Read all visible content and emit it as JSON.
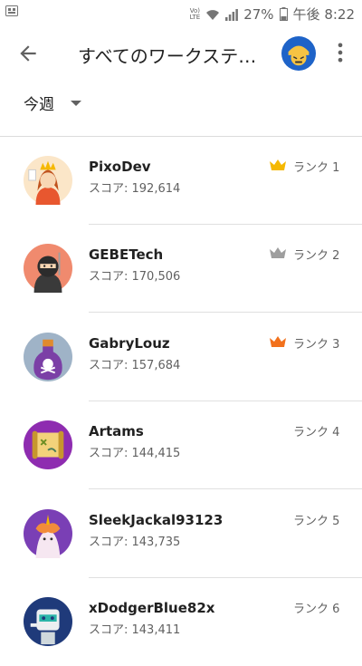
{
  "status_bar": {
    "battery": "27%",
    "time": "午後 8:22"
  },
  "app_bar": {
    "title": "すべてのワークステーション"
  },
  "filter": {
    "period": "今週"
  },
  "leaderboard": {
    "score_prefix": "スコア: ",
    "rows": [
      {
        "name": "PixoDev",
        "score": "192,614",
        "rank": "ランク 1",
        "crown": "gold",
        "avatar": "queen"
      },
      {
        "name": "GEBETech",
        "score": "170,506",
        "rank": "ランク 2",
        "crown": "silver",
        "avatar": "ninja"
      },
      {
        "name": "GabryLouz",
        "score": "157,684",
        "rank": "ランク 3",
        "crown": "bronze",
        "avatar": "poison-bottle"
      },
      {
        "name": "Artams",
        "score": "144,415",
        "rank": "ランク 4",
        "crown": "",
        "avatar": "treasure-map"
      },
      {
        "name": "SleekJackal93123",
        "score": "143,735",
        "rank": "ランク 5",
        "crown": "",
        "avatar": "unicorn"
      },
      {
        "name": "xDodgerBlue82x",
        "score": "143,411",
        "rank": "ランク 6",
        "crown": "",
        "avatar": "robot"
      }
    ]
  },
  "colors": {
    "gold_crown": "#F5B800",
    "silver_crown": "#9E9E9E",
    "bronze_crown": "#F2711C",
    "divider": "#e0e0e0"
  }
}
